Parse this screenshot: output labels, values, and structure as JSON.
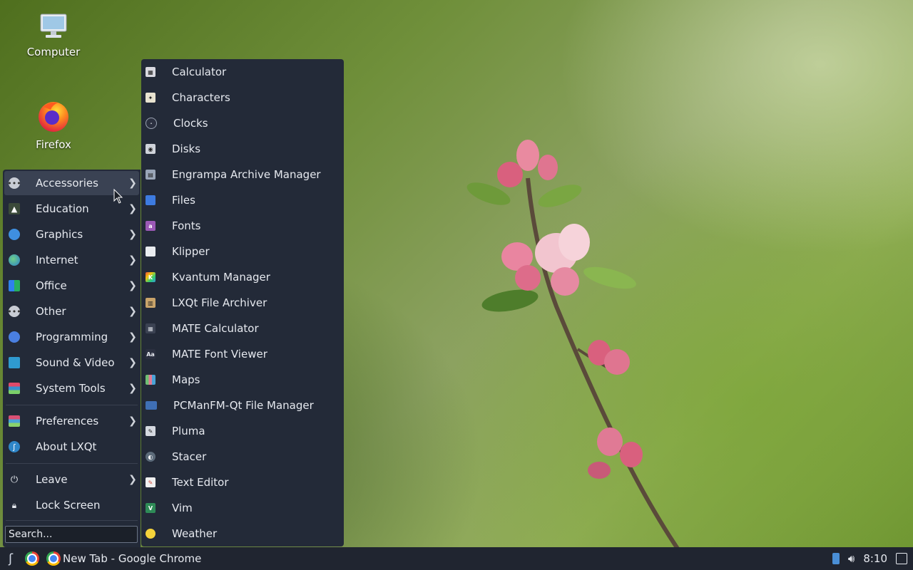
{
  "desktop": {
    "icons": [
      {
        "label": "Computer",
        "icon": "computer-icon"
      },
      {
        "label": "Firefox",
        "icon": "firefox-icon"
      }
    ]
  },
  "main_menu": {
    "items": [
      {
        "label": "Accessories",
        "icon": "accessories-icon",
        "submenu": true,
        "active": true
      },
      {
        "label": "Education",
        "icon": "education-icon",
        "submenu": true
      },
      {
        "label": "Graphics",
        "icon": "graphics-icon",
        "submenu": true
      },
      {
        "label": "Internet",
        "icon": "internet-icon",
        "submenu": true
      },
      {
        "label": "Office",
        "icon": "office-icon",
        "submenu": true
      },
      {
        "label": "Other",
        "icon": "other-icon",
        "submenu": true
      },
      {
        "label": "Programming",
        "icon": "programming-icon",
        "submenu": true
      },
      {
        "label": "Sound & Video",
        "icon": "sound-video-icon",
        "submenu": true
      },
      {
        "label": "System Tools",
        "icon": "system-tools-icon",
        "submenu": true
      },
      {
        "label": "Preferences",
        "icon": "preferences-icon",
        "submenu": true
      },
      {
        "label": "About LXQt",
        "icon": "lxqt-icon",
        "submenu": false
      },
      {
        "label": "Leave",
        "icon": "power-icon",
        "submenu": true
      },
      {
        "label": "Lock Screen",
        "icon": "lock-icon",
        "submenu": false
      }
    ],
    "search_placeholder": "Search..."
  },
  "submenu": {
    "items": [
      {
        "label": "Calculator",
        "icon": "calculator-icon",
        "color": "#d9d9e0"
      },
      {
        "label": "Characters",
        "icon": "characters-icon",
        "color": "#e8e3d0"
      },
      {
        "label": "Clocks",
        "icon": "clock-icon",
        "color": "#2b3040"
      },
      {
        "label": "Disks",
        "icon": "disks-icon",
        "color": "#cfd3da"
      },
      {
        "label": "Engrampa Archive Manager",
        "icon": "archive-icon",
        "color": "#9aa6b8"
      },
      {
        "label": "Files",
        "icon": "files-icon",
        "color": "#3d7be0"
      },
      {
        "label": "Fonts",
        "icon": "fonts-icon",
        "color": "#9b59b6"
      },
      {
        "label": "Klipper",
        "icon": "klipper-icon",
        "color": "#e9ecef"
      },
      {
        "label": "Kvantum Manager",
        "icon": "kvantum-icon",
        "color": "#e74c3c"
      },
      {
        "label": "LXQt File Archiver",
        "icon": "file-archiver-icon",
        "color": "#c9a46a"
      },
      {
        "label": "MATE Calculator",
        "icon": "mate-calculator-icon",
        "color": "#3b4252"
      },
      {
        "label": "MATE Font Viewer",
        "icon": "font-viewer-icon",
        "color": "#2b3040"
      },
      {
        "label": "Maps",
        "icon": "maps-icon",
        "color": "#6fbf73"
      },
      {
        "label": "PCManFM-Qt File Manager",
        "icon": "file-manager-icon",
        "color": "#3f6fb5"
      },
      {
        "label": "Pluma",
        "icon": "pluma-icon",
        "color": "#d5d9e0"
      },
      {
        "label": "Stacer",
        "icon": "stacer-icon",
        "color": "#5c6b7a"
      },
      {
        "label": "Text Editor",
        "icon": "text-editor-icon",
        "color": "#f0f0f0"
      },
      {
        "label": "Vim",
        "icon": "vim-icon",
        "color": "#2e8b57"
      },
      {
        "label": "Weather",
        "icon": "weather-icon",
        "color": "#f5d33b"
      }
    ]
  },
  "taskbar": {
    "task_label": "New Tab - Google Chrome",
    "clock": "8:10"
  }
}
